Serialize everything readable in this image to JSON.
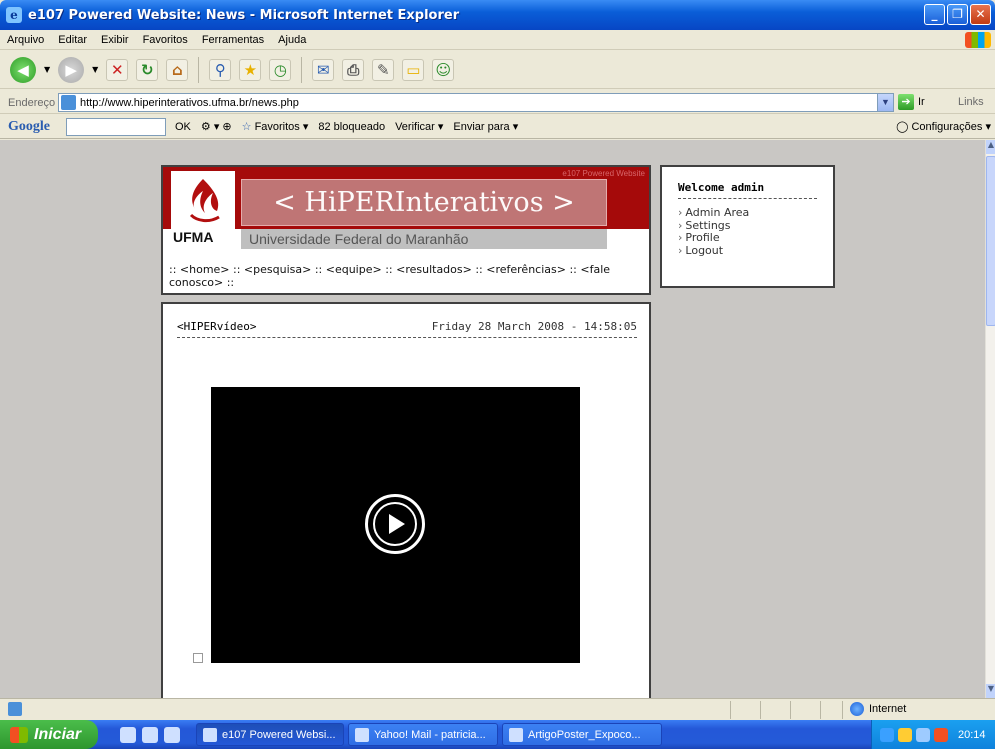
{
  "window": {
    "title": "e107 Powered Website: News - Microsoft Internet Explorer"
  },
  "menu": [
    "Arquivo",
    "Editar",
    "Exibir",
    "Favoritos",
    "Ferramentas",
    "Ajuda"
  ],
  "address": {
    "label": "Endereço",
    "url": "http://www.hiperinterativos.ufma.br/news.php",
    "go": "Ir",
    "links": "Links"
  },
  "google": {
    "logo": "Google",
    "ok": "OK",
    "favoritos": "Favoritos",
    "bloqueado": "82 bloqueado",
    "verificar": "Verificar",
    "enviar": "Enviar para",
    "config": "Configurações"
  },
  "header": {
    "credit": "e107 Powered Website",
    "logo_text": "UFMA",
    "title": "< HiPERInterativos >",
    "subtitle": "Universidade Federal do Maranhão",
    "nav": ":: <home> :: <pesquisa> :: <equipe> :: <resultados> :: <referências> :: <fale conosco> ::"
  },
  "user": {
    "welcome": "Welcome admin",
    "links": [
      "Admin Area",
      "Settings",
      "Profile",
      "Logout"
    ]
  },
  "news": {
    "title": "<HIPERvídeo>",
    "date": "Friday 28 March 2008 - 14:58:05"
  },
  "status": {
    "zone": "Internet"
  },
  "taskbar": {
    "start": "Iniciar",
    "tasks": [
      "e107 Powered Websi...",
      "Yahoo! Mail - patricia...",
      "ArtigoPoster_Expoco..."
    ],
    "clock": "20:14"
  },
  "colors": {
    "title_blue": "#0a5ed8",
    "banner_red": "#a50a0a",
    "taskbar_blue": "#245ad8",
    "start_green": "#2e962e"
  }
}
